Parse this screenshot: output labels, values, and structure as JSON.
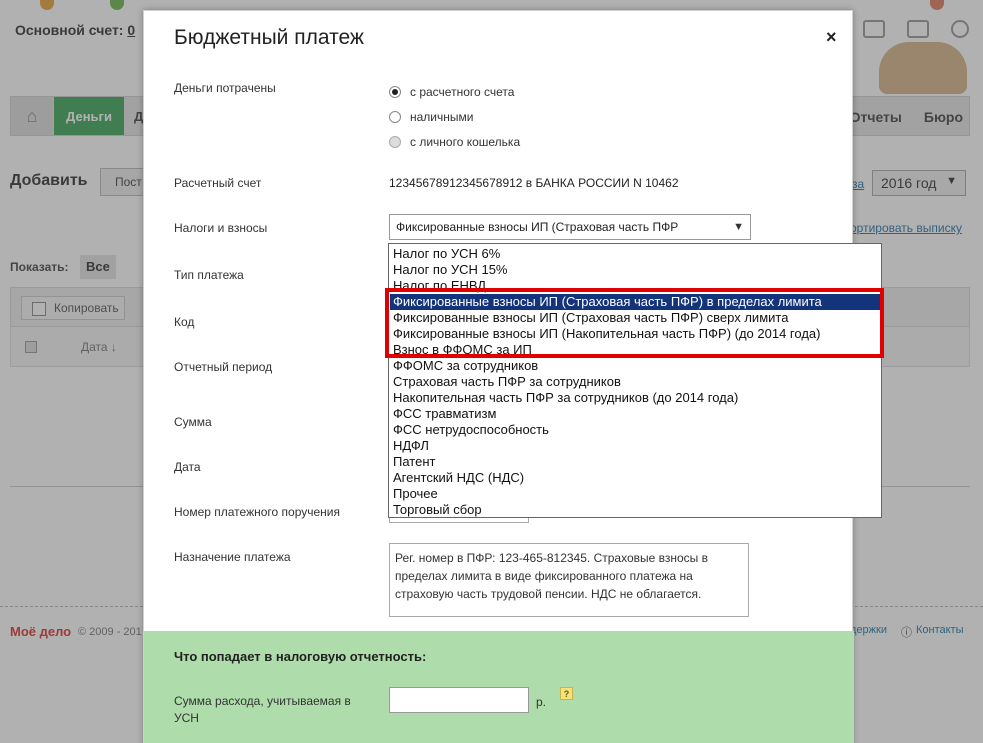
{
  "background": {
    "account_label": "Основной счет:",
    "account_value": "0",
    "nav": {
      "money": "Деньги",
      "partial": "Д",
      "reports": "Отчеты",
      "bureau": "Бюро"
    },
    "add_label": "Добавить",
    "add_btn_partial": "Пост",
    "year_select": "2016 год",
    "year_link_partial": "за",
    "import_link_partial": "ортировать выписку",
    "show_label": "Показать:",
    "show_all": "Все",
    "copy_btn": "Копировать",
    "date_col": "Дата ↓",
    "footer_logo": "Моё дело",
    "footer_copy": "© 2009 - 201",
    "footer_support_partial": "держки",
    "footer_contacts": "Контакты"
  },
  "modal": {
    "title": "Бюджетный платеж",
    "close": "×",
    "labels": {
      "money_spent": "Деньги потрачены",
      "account": "Расчетный счет",
      "taxes": "Налоги и взносы",
      "payment_type": "Тип платежа",
      "code": "Код",
      "period": "Отчетный период",
      "sum": "Сумма",
      "date": "Дата",
      "order_number": "Номер платежного поручения",
      "purpose": "Назначение платежа"
    },
    "radios": [
      {
        "label": "с расчетного счета",
        "checked": true,
        "disabled": false
      },
      {
        "label": "наличными",
        "checked": false,
        "disabled": false
      },
      {
        "label": "с личного кошелька",
        "checked": false,
        "disabled": true
      }
    ],
    "account_value": "12345678912345678912 в БАНКА РОССИИ N 10462",
    "taxes_select_value": "Фиксированные взносы ИП (Страховая часть ПФР",
    "purpose_text": "Рег. номер в ПФР: 123-465-812345. Страховые взносы в пределах лимита в виде фиксированного платежа на страховую часть трудовой пенсии. НДС не облагается.",
    "tax_section_title": "Что попадает в налоговую отчетность:",
    "usn_label": "Сумма расхода, учитываемая в УСН",
    "currency": "р.",
    "help": "?"
  },
  "dropdown": {
    "options": [
      "Налог по УСН 6%",
      "Налог по УСН 15%",
      "Налог по ЕНВД",
      "Фиксированные взносы ИП (Страховая часть ПФР) в пределах лимита",
      "Фиксированные взносы ИП (Страховая часть ПФР) сверх лимита",
      "Фиксированные взносы ИП (Накопительная часть ПФР) (до 2014 года)",
      "Взнос в ФФОМС за ИП",
      "ФФОМС за сотрудников",
      "Страховая часть ПФР за сотрудников",
      "Накопительная часть ПФР за сотрудников (до 2014 года)",
      "ФСС травматизм",
      "ФСС нетрудоспособность",
      "НДФЛ",
      "Патент",
      "Агентский НДС (НДС)",
      "Прочее",
      "Торговый сбор"
    ],
    "selected_index": 3
  },
  "colors": {
    "money_tab": "#3da85c",
    "selection": "#13347a",
    "highlight_box": "#e00000",
    "tax_section_bg": "#aeddab"
  }
}
